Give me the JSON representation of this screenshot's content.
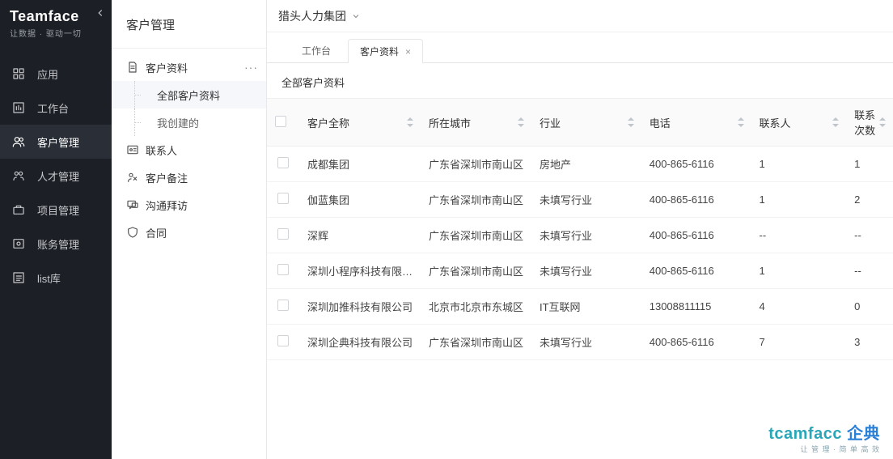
{
  "brand": {
    "title": "Teamface",
    "subtitle": "让数据 · 驱动一切"
  },
  "nav": {
    "items": [
      {
        "label": "应用",
        "icon": "grid"
      },
      {
        "label": "工作台",
        "icon": "chart"
      },
      {
        "label": "客户管理",
        "icon": "users",
        "active": true
      },
      {
        "label": "人才管理",
        "icon": "people"
      },
      {
        "label": "项目管理",
        "icon": "briefcase"
      },
      {
        "label": "账务管理",
        "icon": "money"
      },
      {
        "label": "list库",
        "icon": "list"
      }
    ]
  },
  "side_panel": {
    "title": "客户管理",
    "tree": [
      {
        "label": "客户资料",
        "icon": "doc",
        "has_more": true,
        "children": [
          {
            "label": "全部客户资料",
            "active": true
          },
          {
            "label": "我创建的"
          }
        ]
      },
      {
        "label": "联系人",
        "icon": "card"
      },
      {
        "label": "客户备注",
        "icon": "note"
      },
      {
        "label": "沟通拜访",
        "icon": "chat"
      },
      {
        "label": "合同",
        "icon": "shield"
      }
    ]
  },
  "topbar": {
    "org": "猎头人力集团"
  },
  "tabs": [
    {
      "label": "工作台",
      "closable": false
    },
    {
      "label": "客户资料",
      "closable": true,
      "active": true
    }
  ],
  "content": {
    "title": "全部客户资料",
    "columns": [
      "客户全称",
      "所在城市",
      "行业",
      "电话",
      "联系人",
      "联系次数"
    ],
    "rows": [
      {
        "name": "成都集团",
        "city": "广东省深圳市南山区",
        "industry": "房地产",
        "phone": "400-865-6116",
        "contacts": "1",
        "count": "1"
      },
      {
        "name": "伽蓝集团",
        "city": "广东省深圳市南山区",
        "industry": "未填写行业",
        "phone": "400-865-6116",
        "contacts": "1",
        "count": "2"
      },
      {
        "name": "深辉",
        "city": "广东省深圳市南山区",
        "industry": "未填写行业",
        "phone": "400-865-6116",
        "contacts": "--",
        "count": "--"
      },
      {
        "name": "深圳小程序科技有限…",
        "city": "广东省深圳市南山区",
        "industry": "未填写行业",
        "phone": "400-865-6116",
        "contacts": "1",
        "count": "--"
      },
      {
        "name": "深圳加推科技有限公司",
        "city": "北京市北京市东城区",
        "industry": "IT互联网",
        "phone": "13008811115",
        "contacts": "4",
        "count": "0"
      },
      {
        "name": "深圳企典科技有限公司",
        "city": "广东省深圳市南山区",
        "industry": "未填写行业",
        "phone": "400-865-6116",
        "contacts": "7",
        "count": "3"
      }
    ]
  },
  "footer": {
    "line1a": "tcamfacc",
    "line1b": "企典",
    "line2": "让 管 理 · 简 单 高 效"
  }
}
